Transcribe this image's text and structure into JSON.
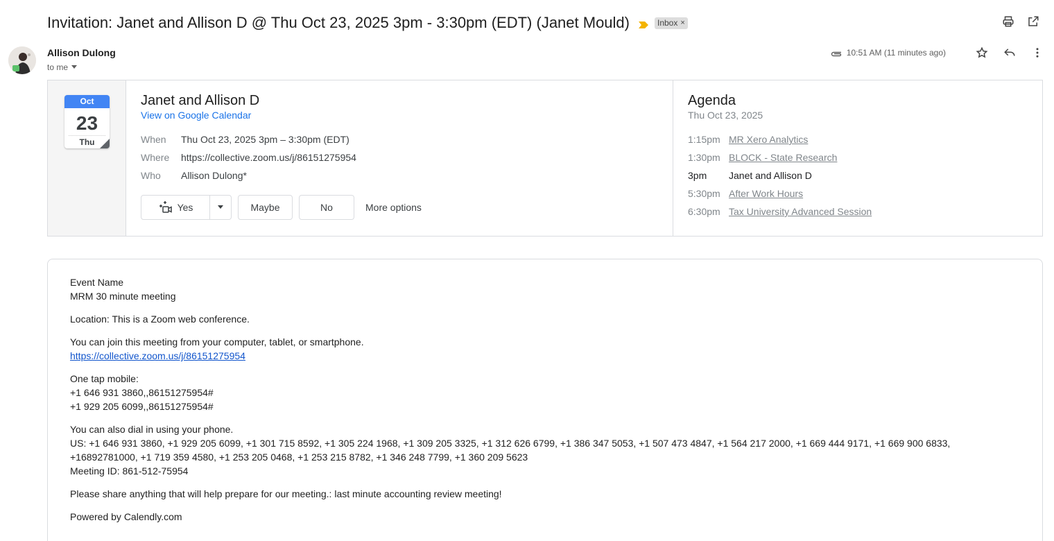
{
  "email": {
    "subject": "Invitation: Janet and Allison D @ Thu Oct 23, 2025 3pm - 3:30pm (EDT) (Janet Mould)",
    "label": "Inbox",
    "sender_name": "Allison Dulong",
    "recipient": "to me",
    "timestamp": "10:51 AM (11 minutes ago)"
  },
  "icons": {
    "importance": "importance-marker-icon",
    "remove_label": "close-icon",
    "print": "print-icon",
    "open_new_window": "open-in-new-icon",
    "attachment": "attachment-icon",
    "star": "star-icon",
    "reply": "reply-icon",
    "more": "more-vert-icon",
    "dropdown": "chevron-down-icon",
    "rsvp_yes": "video-call-icon"
  },
  "colors": {
    "importance": "#f4b400",
    "calendar_month": "#4285f4",
    "link": "#1a73e8"
  },
  "invite": {
    "calendar": {
      "month": "Oct",
      "day": "23",
      "weekday": "Thu"
    },
    "title": "Janet and Allison D",
    "gcal_link": "View on Google Calendar",
    "when_label": "When",
    "when_value": "Thu Oct 23, 2025 3pm – 3:30pm (EDT)",
    "where_label": "Where",
    "where_value": "https://collective.zoom.us/j/86151275954",
    "who_label": "Who",
    "who_value": "Allison Dulong*",
    "rsvp": {
      "yes": "Yes",
      "maybe": "Maybe",
      "no": "No",
      "more": "More options"
    }
  },
  "agenda": {
    "title": "Agenda",
    "date": "Thu Oct 23, 2025",
    "items": [
      {
        "time": "1:15pm",
        "name": "MR Xero Analytics"
      },
      {
        "time": "1:30pm",
        "name": "BLOCK - State Research"
      },
      {
        "time": "3pm",
        "name": "Janet and Allison D"
      },
      {
        "time": "5:30pm",
        "name": "After Work Hours"
      },
      {
        "time": "6:30pm",
        "name": "Tax University Advanced Session"
      }
    ]
  },
  "body": {
    "event_name_label": "Event Name",
    "event_name": "MRM 30 minute meeting",
    "location": "Location: This is a Zoom web conference.",
    "join_text": "You can join this meeting from your computer, tablet, or smartphone.",
    "join_link": "https://collective.zoom.us/j/86151275954",
    "one_tap_label": "One tap mobile:",
    "one_tap_1": "+1 646 931 3860,,86151275954#",
    "one_tap_2": "+1 929 205 6099,,86151275954#",
    "dial_in_label": "You can also dial in using your phone.",
    "dial_in_numbers_1": "US: +1 646 931 3860, +1 929 205 6099, +1 301 715 8592, +1 305 224 1968, +1 309 205 3325, +1 312 626 6799, +1 386 347 5053, +1 507 473 4847, +1 564 217 2000, +1 669 444 9171, +1 669 900 6833,",
    "dial_in_numbers_2": "+16892781000, +1 719 359 4580, +1 253 205 0468, +1 253 215 8782, +1 346 248 7799, +1 360 209 5623",
    "meeting_id": "Meeting ID: 861-512-75954",
    "share_text": "Please share anything that will help prepare for our meeting.: last minute accounting review meeting!",
    "powered_by": "Powered by Calendly.com"
  }
}
